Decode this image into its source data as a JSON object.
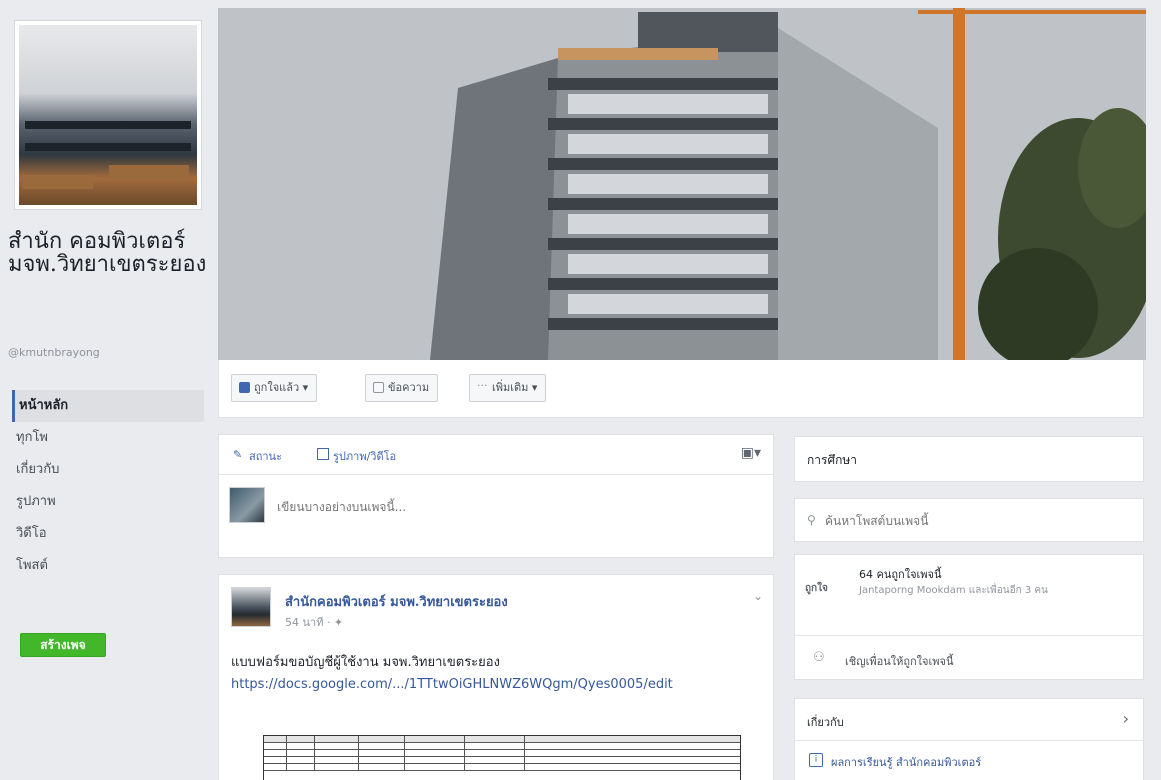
{
  "page": {
    "name": "สำนัก คอมพิวเตอร์ มจพ.วิทยาเขตระยอง",
    "handle": "@kmutnbrayong"
  },
  "nav": {
    "items": [
      {
        "label": "หน้าหลัก",
        "active": true
      },
      {
        "label": "ทุกโพ"
      },
      {
        "label": "เกี่ยวกับ"
      },
      {
        "label": "รูปภาพ"
      },
      {
        "label": "วิดีโอ"
      },
      {
        "label": "โพสต์"
      }
    ],
    "create_label": "สร้างเพจ"
  },
  "actions": {
    "liked_label": "ถูกใจแล้ว ▾",
    "message_label": "ข้อความ",
    "more_label": "เพิ่มเติม ▾"
  },
  "composer": {
    "status_tab": "สถานะ",
    "photo_tab": "รูปภาพ/วิดีโอ",
    "placeholder": "เขียนบางอย่างบนเพจนี้..."
  },
  "post": {
    "author": "สำนักคอมพิวเตอร์ มจพ.วิทยาเขตระยอง",
    "time": "54 นาที · ✦",
    "text": "แบบฟอร์มขอบัญชีผู้ใช้งาน มจพ.วิทยาเขตระยอง",
    "link": "https://docs.google.com/.../1TTtwOiGHLNWZ6WQgm/Qyes0005/edit"
  },
  "right": {
    "about_title": "การศึกษา",
    "search_placeholder": "ค้นหาโพสต์บนเพจนี้",
    "likes_label": "ถูกใจ",
    "likes_count": "64 คนถูกใจเพจนี้",
    "likes_detail": "Jantaporng Mookdam และเพื่อนอีก 3 คน",
    "invite_text": "เชิญเพื่อนให้ถูกใจเพจนี้",
    "upcoming_title": "เกี่ยวกับ",
    "upcoming_item": "ผลการเรียนรู้ สำนักคอมพิวเตอร์"
  },
  "colors": {
    "brand": "#4267b2",
    "create_button": "#42b72a",
    "link": "#365899"
  }
}
